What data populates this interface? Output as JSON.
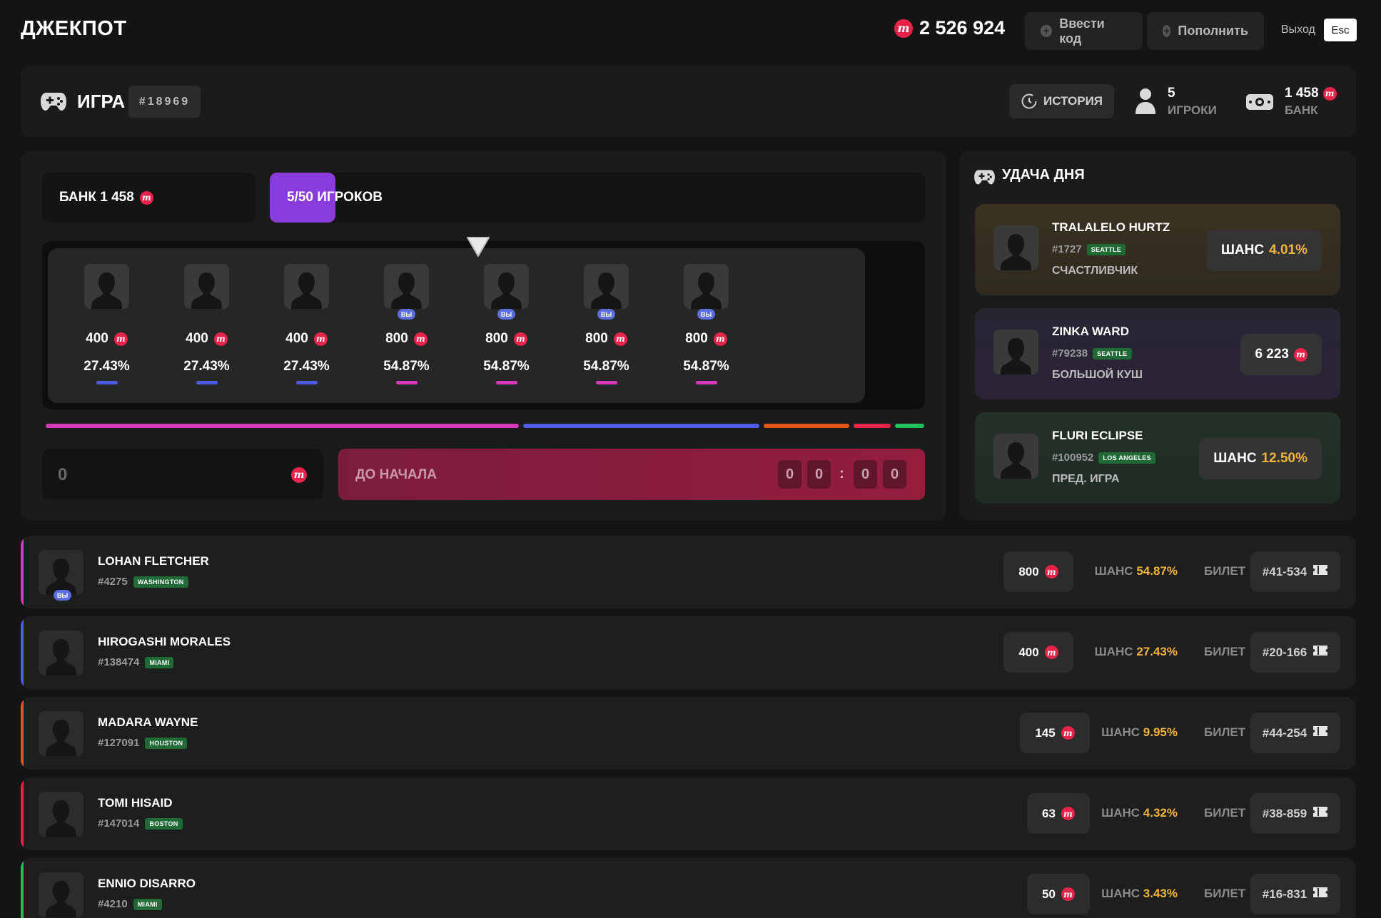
{
  "header": {
    "logo": "ДЖЕКПОТ",
    "balance": "2 526 924",
    "enter_code": "Ввести код",
    "deposit": "Пополнить",
    "logout": "Выход",
    "esc": "Esc"
  },
  "game": {
    "title": "ИГРА",
    "id": "#18969",
    "history": "ИСТОРИЯ",
    "players_count": "5",
    "players_label": "ИГРОКИ",
    "bank_value": "1 458",
    "bank_label": "БАНК"
  },
  "round": {
    "bank_label": "БАНК 1 458",
    "players_label": "5/50 ИГРОКОВ",
    "players_fill": 0.1,
    "cards": [
      {
        "amount": "400",
        "chance": "27.43%",
        "you": "",
        "color": "#4f5be6"
      },
      {
        "amount": "400",
        "chance": "27.43%",
        "you": "",
        "color": "#4f5be6"
      },
      {
        "amount": "400",
        "chance": "27.43%",
        "you": "",
        "color": "#4f5be6"
      },
      {
        "amount": "800",
        "chance": "54.87%",
        "you": "ВЫ",
        "color": "#d63ab9"
      },
      {
        "amount": "800",
        "chance": "54.87%",
        "you": "ВЫ",
        "color": "#d63ab9"
      },
      {
        "amount": "800",
        "chance": "54.87%",
        "you": "ВЫ",
        "color": "#d63ab9"
      },
      {
        "amount": "800",
        "chance": "54.87%",
        "you": "ВЫ",
        "color": "#d63ab9"
      }
    ],
    "segments": [
      {
        "share": 0.5487,
        "color": "#d63ab9"
      },
      {
        "share": 0.2743,
        "color": "#4f5be6"
      },
      {
        "share": 0.0995,
        "color": "#e2571a"
      },
      {
        "share": 0.0432,
        "color": "#e8234a"
      },
      {
        "share": 0.0343,
        "color": "#1fbf5b"
      }
    ],
    "bet_value": "0",
    "start_label": "ДО НАЧАЛА",
    "timer": [
      "0",
      "0",
      "0",
      "0"
    ],
    "colon": ":"
  },
  "luck": {
    "title": "УДАЧА ДНЯ",
    "cards": [
      {
        "name": "TRALALELO HURTZ",
        "id": "#1727",
        "city": "SEATTLE",
        "title": "СЧАСТЛИВЧИК",
        "badge_label": "ШАНС",
        "badge_value": "4.01%",
        "coin": false
      },
      {
        "name": "ZINKA WARD",
        "id": "#79238",
        "city": "SEATTLE",
        "title": "БОЛЬШОЙ КУШ",
        "badge_label": "",
        "badge_value": "6 223",
        "coin": true
      },
      {
        "name": "FLURI ECLIPSE",
        "id": "#100952",
        "city": "LOS ANGELES",
        "title": "ПРЕД. ИГРА",
        "badge_label": "ШАНС",
        "badge_value": "12.50%",
        "coin": false
      }
    ]
  },
  "players": [
    {
      "name": "LOHAN FLETCHER",
      "id": "#4275",
      "city": "WASHINGTON",
      "you": "ВЫ",
      "amount": "800",
      "chance_label": "ШАНС",
      "chance": "54.87%",
      "ticket_label": "БИЛЕТ",
      "ticket": "#41-534",
      "color": "#d63ab9"
    },
    {
      "name": "HIROGASHI MORALES",
      "id": "#138474",
      "city": "MIAMI",
      "you": "",
      "amount": "400",
      "chance_label": "ШАНС",
      "chance": "27.43%",
      "ticket_label": "БИЛЕТ",
      "ticket": "#20-166",
      "color": "#4f5be6"
    },
    {
      "name": "MADARA WAYNE",
      "id": "#127091",
      "city": "HOUSTON",
      "you": "",
      "amount": "145",
      "chance_label": "ШАНС",
      "chance": "9.95%",
      "ticket_label": "БИЛЕТ",
      "ticket": "#44-254",
      "color": "#e2571a"
    },
    {
      "name": "TOMI HISAID",
      "id": "#147014",
      "city": "BOSTON",
      "you": "",
      "amount": "63",
      "chance_label": "ШАНС",
      "chance": "4.32%",
      "ticket_label": "БИЛЕТ",
      "ticket": "#38-859",
      "color": "#e8234a"
    },
    {
      "name": "ENNIO DISARRO",
      "id": "#4210",
      "city": "MIAMI",
      "you": "",
      "amount": "50",
      "chance_label": "ШАНС",
      "chance": "3.43%",
      "ticket_label": "БИЛЕТ",
      "ticket": "#16-831",
      "color": "#1fbf5b"
    }
  ]
}
